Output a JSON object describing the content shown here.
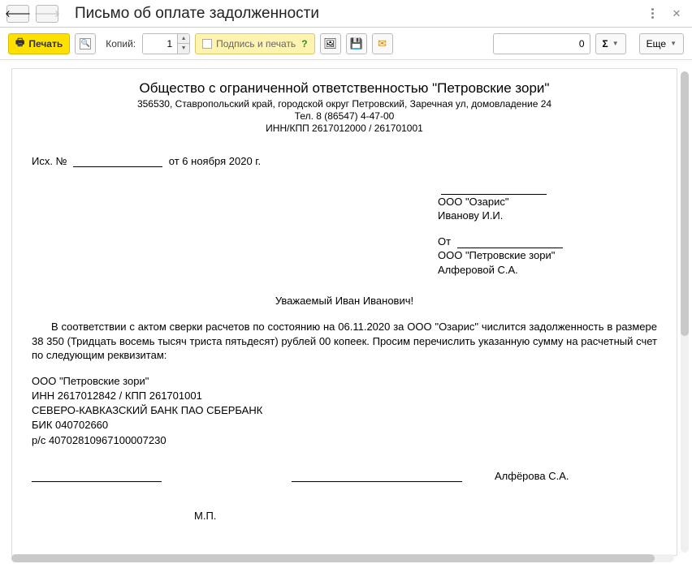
{
  "window": {
    "title": "Письмо об оплате задолженности"
  },
  "toolbar": {
    "print": "Печать",
    "copies_label": "Копий:",
    "copies_value": "1",
    "sign_print": "Подпись и печать",
    "sum_value": "0",
    "sigma": "Σ",
    "more": "Еще"
  },
  "doc": {
    "org_name": "Общество с ограниченной ответственностью \"Петровские зори\"",
    "address": "356530, Ставропольский край, городской округ Петровский, Заречная ул, домовладение 24",
    "phone": "Тел. 8 (86547) 4-47-00",
    "inn_kpp": "ИНН/КПП 2617012000 / 261701001",
    "out_prefix": "Исх. №",
    "out_date_prefix": "от",
    "out_date": "6 ноября 2020 г.",
    "to_org": "ООО \"Озарис\"",
    "to_person": "Иванову  И.И.",
    "from_label": "От",
    "from_org": "ООО \"Петровские зори\"",
    "from_person": "Алферовой С.А.",
    "salutation": "Уважаемый Иван Иванович!",
    "body": "В соответствии с актом сверки расчетов по состоянию на 06.11.2020 за ООО \"Озарис\" числится задолженность в размере 38 350 (Тридцать восемь тысяч триста пятьдесят) рублей 00 копеек. Просим перечислить указанную сумму на расчетный счет  по следующим реквизитам:",
    "req_org": "ООО \"Петровские зори\"",
    "req_inn": "ИНН 2617012842 / КПП 261701001",
    "req_bank": "СЕВЕРО-КАВКАЗСКИЙ БАНК ПАО СБЕРБАНК",
    "req_bik": "БИК 040702660",
    "req_acct": "р/с 40702810967100007230",
    "sign_name": "Алфёрова С.А.",
    "stamp": "М.П."
  }
}
